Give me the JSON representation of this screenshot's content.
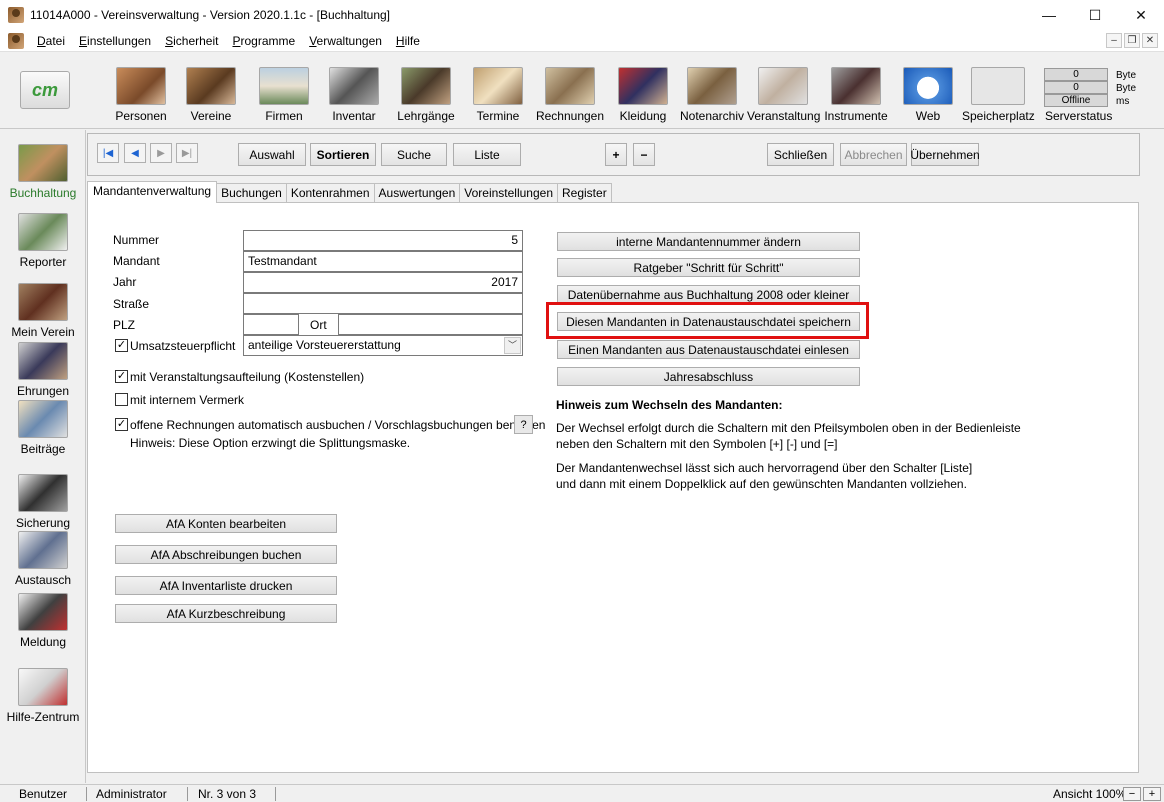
{
  "window": {
    "title": "11014A000 - Vereinsverwaltung - Version 2020.1.1c - [Buchhaltung]"
  },
  "menu": [
    "Datei",
    "Einstellungen",
    "Sicherheit",
    "Programme",
    "Verwaltungen",
    "Hilfe"
  ],
  "toolbar": {
    "logo": "cm",
    "items": [
      "Personen",
      "Vereine",
      "Firmen",
      "Inventar",
      "Lehrgänge",
      "Termine",
      "Rechnungen",
      "Kleidung",
      "Notenarchiv",
      "Veranstaltung",
      "Instrumente",
      "Web",
      "Speicherplatz"
    ],
    "server": {
      "row1": "0",
      "row2": "0",
      "row3": "Offline",
      "unit1": "Byte",
      "unit2": "Byte",
      "unit3": "ms",
      "label": "Serverstatus"
    }
  },
  "sidebar": [
    "Buchhaltung",
    "Reporter",
    "Mein Verein",
    "Ehrungen",
    "Beiträge",
    "Sicherung",
    "Austausch",
    "Meldung",
    "Hilfe-Zentrum"
  ],
  "nav": {
    "first": "|◀",
    "prev": "◀",
    "next": "▶",
    "last": "▶|",
    "auswahl": "Auswahl",
    "sortieren": "Sortieren",
    "suche": "Suche",
    "liste": "Liste",
    "plus": "+",
    "minus": "−",
    "schliessen": "Schließen",
    "abbrechen": "Abbrechen",
    "uebernehmen": "Übernehmen"
  },
  "tabs": [
    "Mandantenverwaltung",
    "Buchungen",
    "Kontenrahmen",
    "Auswertungen",
    "Voreinstellungen",
    "Register"
  ],
  "form": {
    "nummer_label": "Nummer",
    "nummer": "5",
    "mandant_label": "Mandant",
    "mandant": "Testmandant",
    "jahr_label": "Jahr",
    "jahr": "2017",
    "strasse_label": "Straße",
    "strasse": "",
    "plz_label": "PLZ",
    "plz": "",
    "ort_label": "Ort",
    "ort": "",
    "ust_label": "Umsatzsteuerpflicht",
    "ust_value": "anteilige Vorsteuererstattung",
    "check1": "mit Veranstaltungsaufteilung (Kostenstellen)",
    "check2": "mit internem Vermerk",
    "check3": "offene Rechnungen automatisch ausbuchen / Vorschlagsbuchungen benutzen",
    "check3_hint": "Hinweis: Diese Option erzwingt die Splittungsmaske.",
    "help": "?"
  },
  "afa": [
    "AfA Konten bearbeiten",
    "AfA Abschreibungen buchen",
    "AfA Inventarliste drucken",
    "AfA Kurzbeschreibung"
  ],
  "actions": [
    "interne Mandantennummer ändern",
    "Ratgeber \"Schritt für Schritt\"",
    "Datenübernahme aus Buchhaltung 2008 oder kleiner",
    "Diesen Mandanten in Datenaustauschdatei speichern",
    "Einen Mandanten aus Datenaustauschdatei  einlesen",
    "Jahresabschluss"
  ],
  "hint": {
    "title": "Hinweis zum Wechseln des Mandanten:",
    "p1a": "Der Wechsel erfolgt durch die Schaltern mit den Pfeilsymbolen oben in der Bedienleiste",
    "p1b": "neben den Schaltern mit den Symbolen [+] [-] und [=]",
    "p2a": "Der Mandantenwechsel lässt sich auch hervorragend über den Schalter [Liste]",
    "p2b": "und dann mit einem Doppelklick auf den gewünschten Mandanten vollziehen."
  },
  "status": {
    "user_label": "Benutzer",
    "user": "Administrator",
    "record": "Nr. 3 von 3",
    "zoom": "Ansicht 100%"
  }
}
